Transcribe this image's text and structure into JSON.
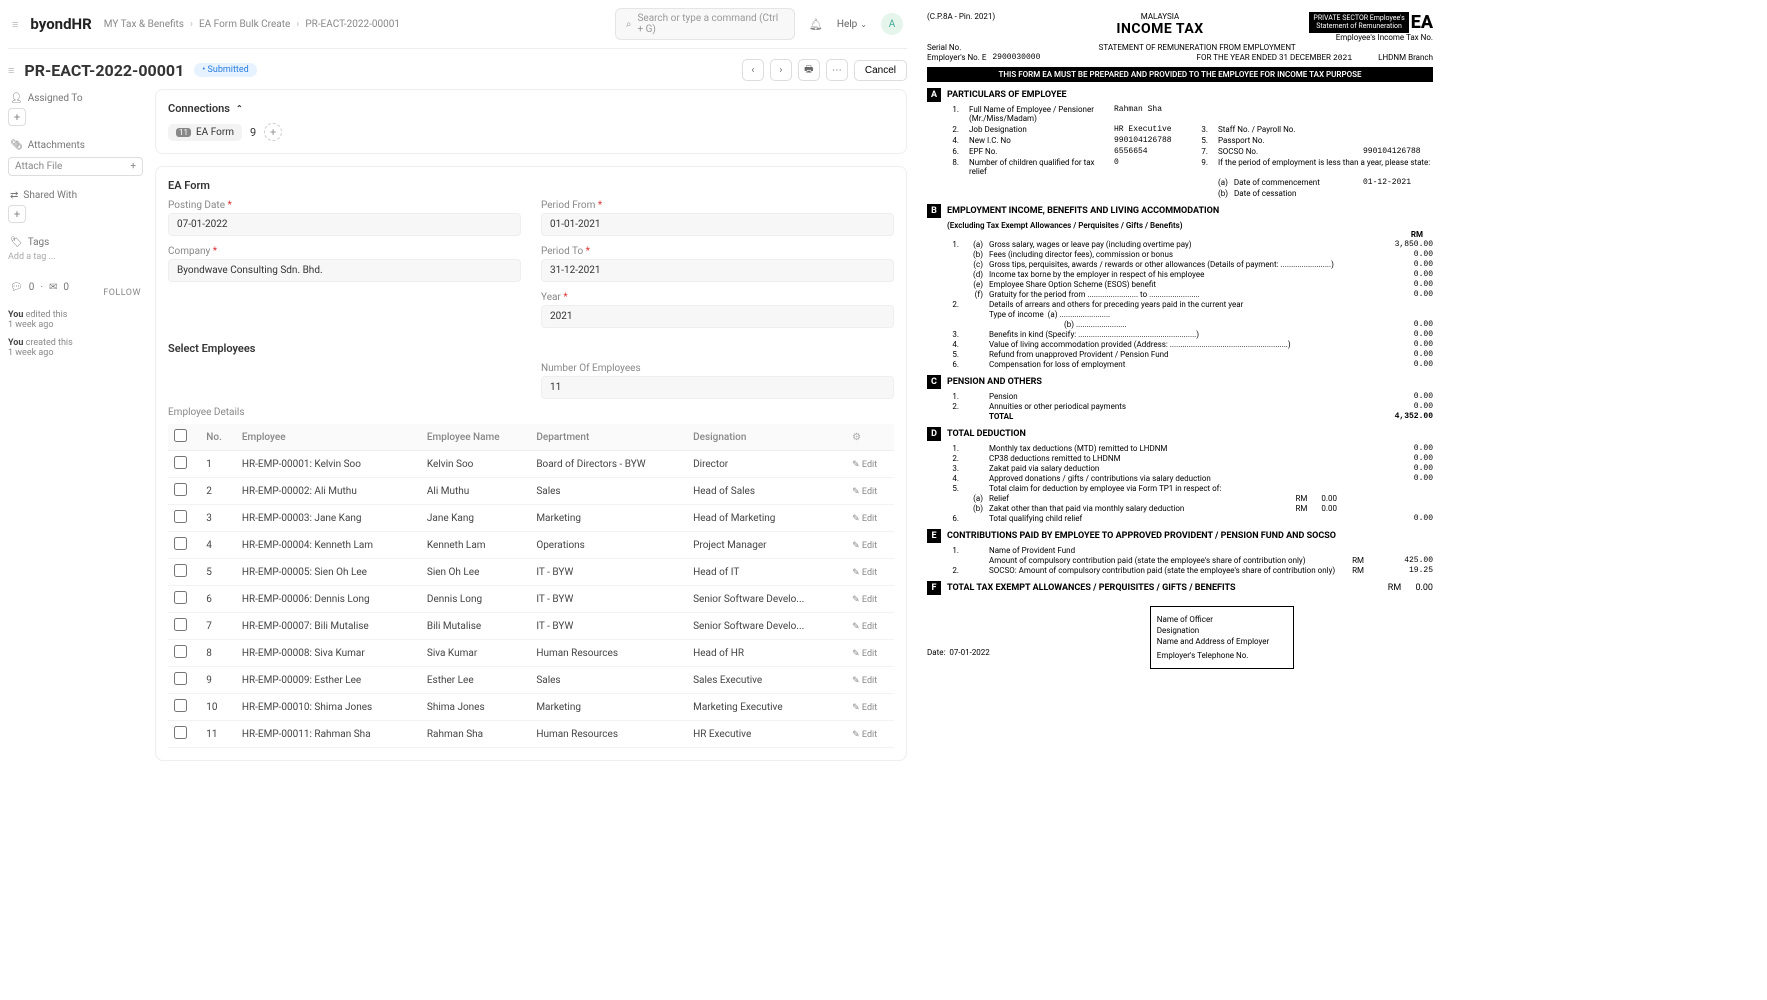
{
  "brand": "byondHR",
  "breadcrumbs": [
    "MY Tax & Benefits",
    "EA Form Bulk Create",
    "PR-EACT-2022-00001"
  ],
  "search_placeholder": "Search or type a command (Ctrl + G)",
  "help": "Help",
  "avatar": "A",
  "doc_title": "PR-EACT-2022-00001",
  "status": "• Submitted",
  "cancel": "Cancel",
  "sidebar": {
    "assigned": "Assigned To",
    "attachments": "Attachments",
    "attach_file": "Attach File",
    "shared": "Shared With",
    "tags": "Tags",
    "add_tag": "Add a tag ...",
    "follow": "FOLLOW",
    "act1_a": "You",
    "act1_b": " edited this",
    "act1_t": "1 week ago",
    "act2_a": "You",
    "act2_b": " created this",
    "act2_t": "1 week ago",
    "zero": "0"
  },
  "connections": {
    "title": "Connections",
    "tab_label": "EA Form",
    "tab_badge": "11",
    "count": "9"
  },
  "ea_form": {
    "heading": "EA Form",
    "posting_date_l": "Posting Date",
    "posting_date": "07-01-2022",
    "period_from_l": "Period From",
    "period_from": "01-01-2021",
    "company_l": "Company",
    "company": "Byondwave Consulting Sdn. Bhd.",
    "period_to_l": "Period To",
    "period_to": "31-12-2021",
    "year_l": "Year",
    "year": "2021"
  },
  "sel_emp": "Select Employees",
  "num_emp_l": "Number Of Employees",
  "num_emp": "11",
  "emp_details": "Employee Details",
  "cols": {
    "no": "No.",
    "emp": "Employee",
    "name": "Employee Name",
    "dept": "Department",
    "desig": "Designation"
  },
  "edit": "Edit",
  "rows": [
    {
      "no": "1",
      "emp": "HR-EMP-00001: Kelvin Soo",
      "name": "Kelvin Soo",
      "dept": "Board of Directors - BYW",
      "desig": "Director"
    },
    {
      "no": "2",
      "emp": "HR-EMP-00002: Ali Muthu",
      "name": "Ali Muthu",
      "dept": "Sales",
      "desig": "Head of Sales"
    },
    {
      "no": "3",
      "emp": "HR-EMP-00003: Jane Kang",
      "name": "Jane Kang",
      "dept": "Marketing",
      "desig": "Head of Marketing"
    },
    {
      "no": "4",
      "emp": "HR-EMP-00004: Kenneth Lam",
      "name": "Kenneth Lam",
      "dept": "Operations",
      "desig": "Project Manager"
    },
    {
      "no": "5",
      "emp": "HR-EMP-00005: Sien Oh Lee",
      "name": "Sien Oh Lee",
      "dept": "IT - BYW",
      "desig": "Head of IT"
    },
    {
      "no": "6",
      "emp": "HR-EMP-00006: Dennis Long",
      "name": "Dennis Long",
      "dept": "IT - BYW",
      "desig": "Senior Software Develo..."
    },
    {
      "no": "7",
      "emp": "HR-EMP-00007: Bili Mutalise",
      "name": "Bili Mutalise",
      "dept": "IT - BYW",
      "desig": "Senior Software Develo..."
    },
    {
      "no": "8",
      "emp": "HR-EMP-00008: Siva Kumar",
      "name": "Siva Kumar",
      "dept": "Human Resources",
      "desig": "Head of HR"
    },
    {
      "no": "9",
      "emp": "HR-EMP-00009: Esther Lee",
      "name": "Esther Lee",
      "dept": "Sales",
      "desig": "Sales Executive"
    },
    {
      "no": "10",
      "emp": "HR-EMP-00010: Shima Jones",
      "name": "Shima Jones",
      "dept": "Marketing",
      "desig": "Marketing Executive"
    },
    {
      "no": "11",
      "emp": "HR-EMP-00011: Rahman Sha",
      "name": "Rahman Sha",
      "dept": "Human Resources",
      "desig": "HR Executive"
    }
  ],
  "pdf": {
    "cp": "(C.P.8A - Pin. 2021)",
    "country": "MALAYSIA",
    "income_tax": "INCOME TAX",
    "badge1": "PRIVATE SECTOR Employee's",
    "badge2": "Statement of Remuneration",
    "ea": "EA",
    "emp_tax": "Employee's Income Tax No.",
    "serial": "Serial No.",
    "stmt": "STATEMENT OF REMUNERATION FROM EMPLOYMENT",
    "empno_l": "Employer's No. E",
    "empno": "2900030000",
    "year_end": "FOR THE YEAR ENDED 31 DECEMBER",
    "year": "2021",
    "branch": "LHDNM Branch",
    "black_bar": "THIS FORM EA MUST BE PREPARED AND PROVIDED TO THE EMPLOYEE FOR INCOME TAX PURPOSE",
    "A": {
      "title": "PARTICULARS OF EMPLOYEE",
      "r1": "Full Name of Employee / Pensioner (Mr./Miss/Madam)",
      "v1": "Rahman Sha",
      "r2": "Job Designation",
      "v2": "HR Executive",
      "r3": "Staff No. / Payroll No.",
      "r4": "New I.C. No",
      "v4": "990104126788",
      "r5": "Passport No.",
      "r6": "EPF No.",
      "v6": "6556654",
      "r7": "SOCSO No.",
      "v7": "990104126788",
      "r8": "Number of children qualified for tax relief",
      "v8": "0",
      "r9": "If the period of employment is less than a year, please state:",
      "r9a": "Date of commencement",
      "v9a": "01-12-2021",
      "r9b": "Date of cessation"
    },
    "B": {
      "title": "EMPLOYMENT INCOME, BENEFITS AND LIVING ACCOMMODATION",
      "sub": "(Excluding Tax Exempt Allowances / Perquisites / Gifts / Benefits)",
      "rm": "RM",
      "b1a": "Gross salary, wages or leave pay (including overtime pay)",
      "v1a": "3,850.00",
      "b1b": "Fees (including director fees), commission or bonus",
      "v1b": "0.00",
      "b1c": "Gross tips, perquisites, awards / rewards or other allowances (Details of payment: ........................)",
      "v1c": "0.00",
      "b1d": "Income tax borne by the employer in respect of his employee",
      "v1d": "0.00",
      "b1e": "Employee Share Option Scheme (ESOS) benefit",
      "v1e": "0.00",
      "b1f": "Gratuity for the period from ........................ to ........................",
      "v1f": "0.00",
      "b2": "Details of arrears and others for preceding years paid in the current year",
      "b2t": "Type of income",
      "b2a": "(a)",
      "b2b": "(b)",
      "v2": "0.00",
      "b3": "Benefits in kind (Specify: ........................................................)",
      "v3": "0.00",
      "b4": "Value of living accommodation provided (Address: ........................................................)",
      "v4": "0.00",
      "b5": "Refund from unapproved Provident / Pension Fund",
      "v5": "0.00",
      "b6": "Compensation for loss of employment",
      "v6": "0.00"
    },
    "C": {
      "title": "PENSION AND OTHERS",
      "c1": "Pension",
      "v1": "0.00",
      "c2": "Annuities or other periodical payments",
      "v2": "0.00",
      "total": "TOTAL",
      "vt": "4,352.00"
    },
    "D": {
      "title": "TOTAL DEDUCTION",
      "d1": "Monthly tax deductions (MTD) remitted to LHDNM",
      "v1": "0.00",
      "d2": "CP38 deductions remitted to LHDNM",
      "v2": "0.00",
      "d3": "Zakat paid via salary deduction",
      "v3": "0.00",
      "d4": "Approved donations / gifts / contributions via salary deduction",
      "v4": "0.00",
      "d5": "Total claim for deduction by employee via Form TP1 in respect of:",
      "d5a": "Relief",
      "d5a_rm": "RM",
      "v5a": "0.00",
      "d5b": "Zakat other than that paid via monthly salary deduction",
      "d5b_rm": "RM",
      "v5b": "0.00",
      "d6": "Total qualifying child relief",
      "v6": "0.00"
    },
    "E": {
      "title": "CONTRIBUTIONS PAID BY EMPLOYEE TO APPROVED PROVIDENT / PENSION FUND AND SOCSO",
      "e1": "Name of Provident Fund",
      "e1b": "Amount of compulsory contribution paid (state the employee's share of contribution only)",
      "rm1": "RM",
      "v1": "425.00",
      "e2": "SOCSO: Amount of compulsory contribution paid (state the employee's share of contribution only)",
      "rm2": "RM",
      "v2": "19.25"
    },
    "F": {
      "title": "TOTAL TAX EXEMPT ALLOWANCES / PERQUISITES / GIFTS / BENEFITS",
      "rm": "RM",
      "v": "0.00"
    },
    "sig": {
      "officer": "Name of Officer",
      "desig": "Designation",
      "addr": "Name and Address of Employer",
      "tel": "Employer's Telephone No."
    },
    "date_l": "Date:",
    "date": "07-01-2022"
  }
}
